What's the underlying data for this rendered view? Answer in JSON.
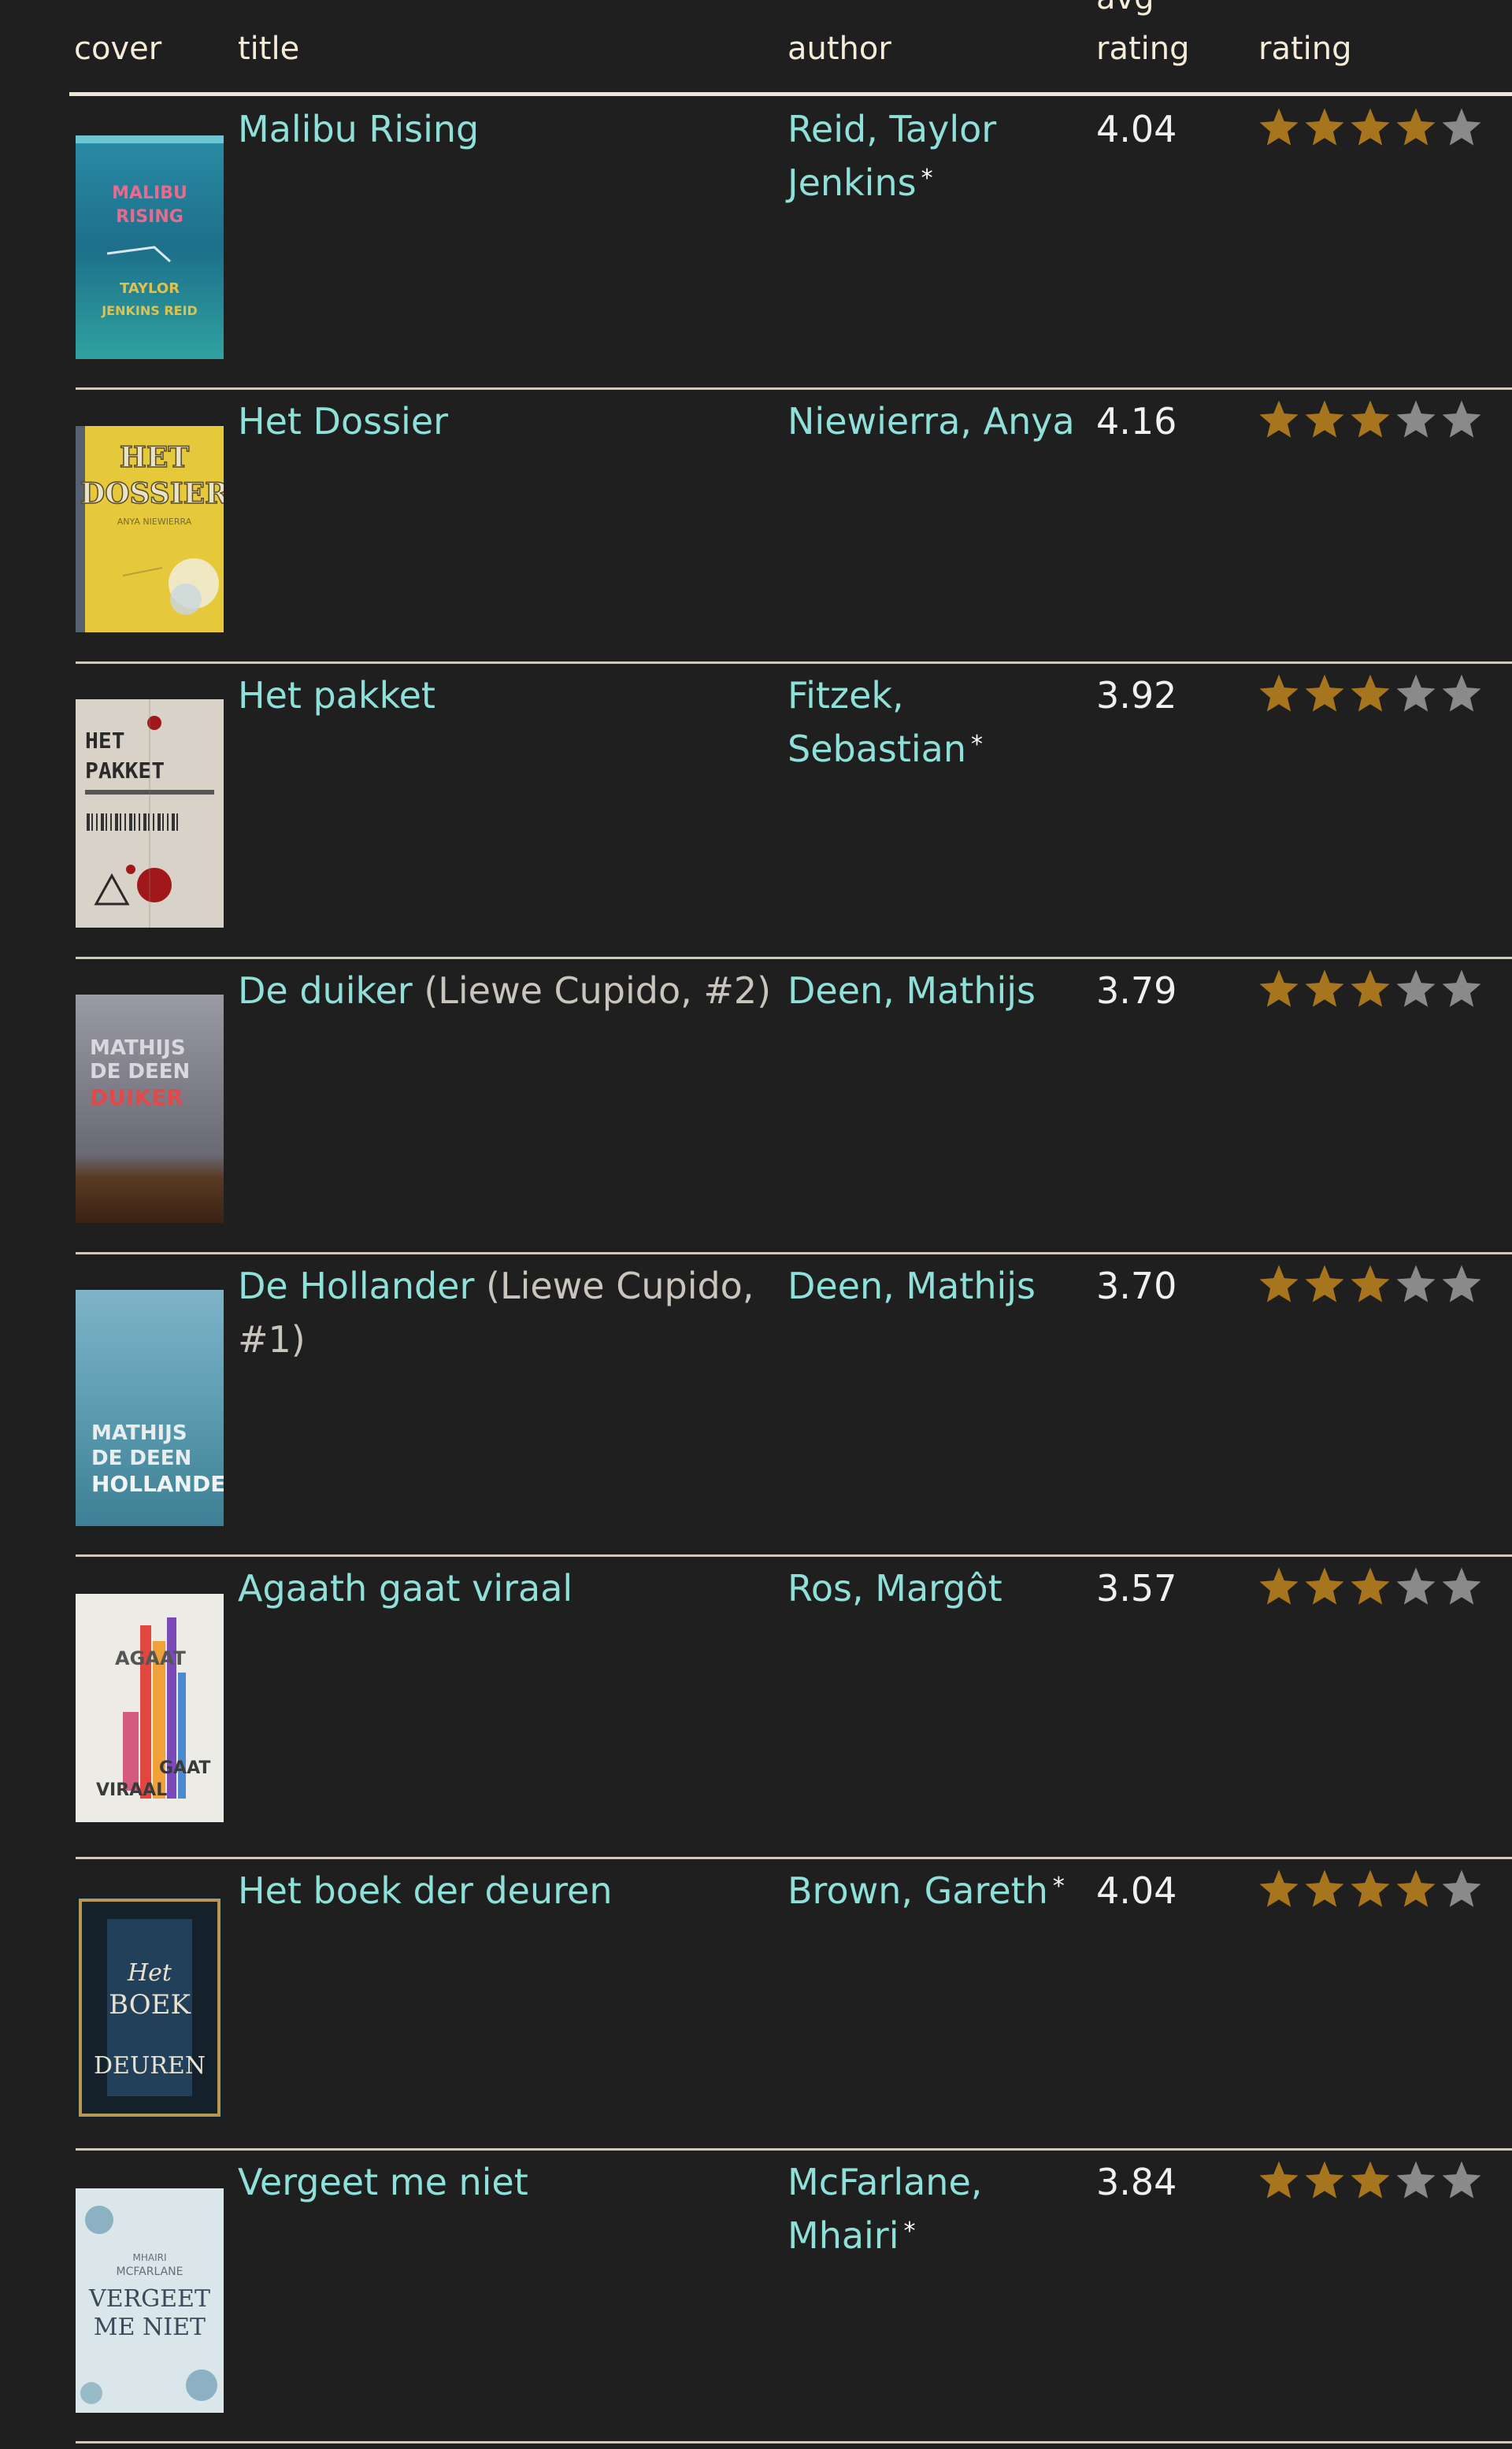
{
  "headers": {
    "cover": "cover",
    "title": "title",
    "author": "author",
    "avg_top": "avg",
    "avg_bottom": "rating",
    "rating": "rating"
  },
  "colors": {
    "background": "#1f1f1f",
    "link": "#8fe0d8",
    "star_filled": "#a8751f",
    "star_empty": "#8a8a8a",
    "header_text": "#f4ecd8"
  },
  "books": [
    {
      "title": "Malibu Rising",
      "series": "",
      "author_line1": "Reid, Taylor",
      "author_line2": "Jenkins",
      "author_marker": "*",
      "avg_rating": "4.04",
      "user_rating": 4,
      "cover": {
        "kind": "malibu",
        "text1": "MALIBU",
        "text2": "RISING",
        "text3": "TAYLOR",
        "text4": "JENKINS REID"
      }
    },
    {
      "title": "Het Dossier",
      "series": "",
      "author_line1": "Niewierra, Anya",
      "author_line2": "",
      "author_marker": "",
      "avg_rating": "4.16",
      "user_rating": 3,
      "cover": {
        "kind": "dossier",
        "text1": "HET",
        "text2": "DOSSIER",
        "text3": "ANYA NIEWIERRA"
      }
    },
    {
      "title": "Het pakket",
      "series": "",
      "author_line1": "Fitzek,",
      "author_line2": "Sebastian",
      "author_marker": "*",
      "avg_rating": "3.92",
      "user_rating": 3,
      "cover": {
        "kind": "pakket",
        "text1": "HET",
        "text2": "PAKKET"
      }
    },
    {
      "title": "De duiker",
      "series": "(Liewe Cupido, #2)",
      "author_line1": "Deen, Mathijs",
      "author_line2": "",
      "author_marker": "",
      "avg_rating": "3.79",
      "user_rating": 3,
      "cover": {
        "kind": "duiker",
        "text1": "MATHIJS",
        "text2": "DE DEEN",
        "text3": "DUIKER"
      }
    },
    {
      "title": "De Hollander",
      "series": "(Liewe Cupido, #1)",
      "author_line1": "Deen, Mathijs",
      "author_line2": "",
      "author_marker": "",
      "avg_rating": "3.70",
      "user_rating": 3,
      "cover": {
        "kind": "hollander",
        "text1": "MATHIJS",
        "text2": "DE DEEN",
        "text3": "HOLLANDER"
      }
    },
    {
      "title": "Agaath gaat viraal",
      "series": "",
      "author_line1": "Ros, Margôt",
      "author_line2": "",
      "author_marker": "",
      "avg_rating": "3.57",
      "user_rating": 3,
      "cover": {
        "kind": "agaath",
        "text1": "AGAAT",
        "text2": "GAAT",
        "text3": "VIRAAL"
      }
    },
    {
      "title": "Het boek der deuren",
      "series": "",
      "author_line1": "Brown, Gareth",
      "author_line2": "",
      "author_marker": "*",
      "avg_rating": "4.04",
      "user_rating": 4,
      "cover": {
        "kind": "deuren",
        "text1": "Het",
        "text2": "BOEK",
        "text3": "DEUREN"
      }
    },
    {
      "title": "Vergeet me niet",
      "series": "",
      "author_line1": "McFarlane,",
      "author_line2": "Mhairi",
      "author_marker": "*",
      "avg_rating": "3.84",
      "user_rating": 3,
      "cover": {
        "kind": "vergeet",
        "text1": "MHAIRI",
        "text2": "MCFARLANE",
        "text3": "VERGEET",
        "text4": "ME NIET"
      }
    }
  ]
}
